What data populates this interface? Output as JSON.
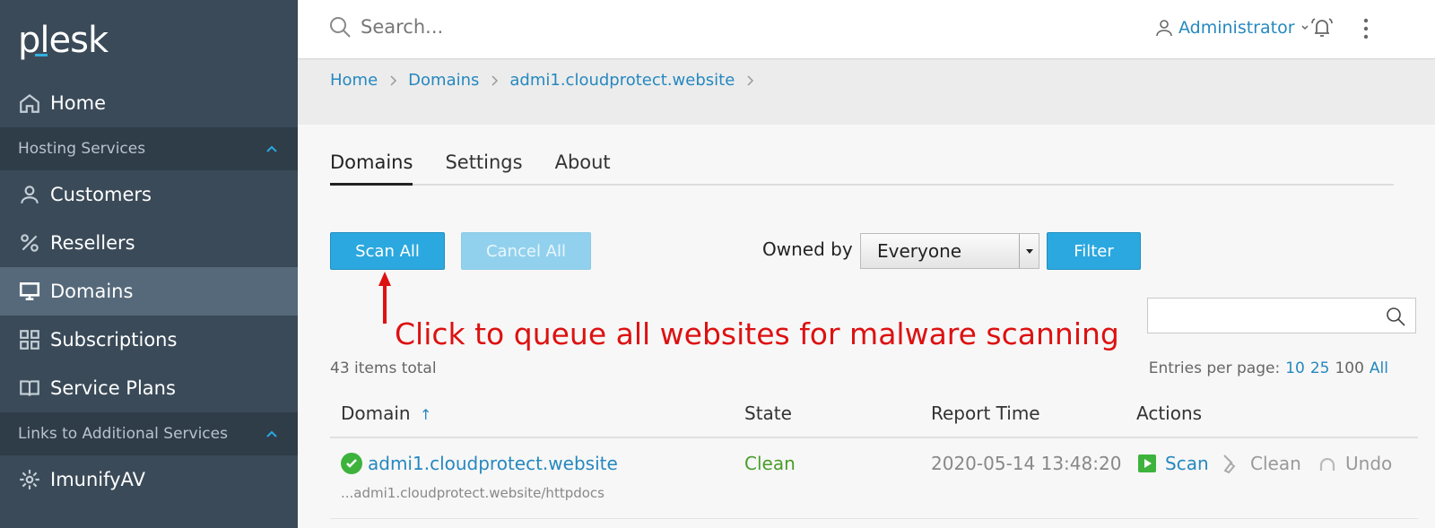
{
  "app": {
    "logo_text": "plesk"
  },
  "sidebar": {
    "items": [
      {
        "label": "Home"
      },
      {
        "group": "Hosting Services"
      },
      {
        "label": "Customers"
      },
      {
        "label": "Resellers"
      },
      {
        "label": "Domains",
        "active": true
      },
      {
        "label": "Subscriptions"
      },
      {
        "label": "Service Plans"
      },
      {
        "group": "Links to Additional Services"
      },
      {
        "label": "ImunifyAV"
      }
    ]
  },
  "topbar": {
    "search_placeholder": "Search...",
    "user": "Administrator"
  },
  "breadcrumb": [
    "Home",
    "Domains",
    "admi1.cloudprotect.website"
  ],
  "tabs": [
    "Domains",
    "Settings",
    "About"
  ],
  "toolbar": {
    "scan_all": "Scan All",
    "cancel_all": "Cancel All",
    "owned_by_label": "Owned by",
    "owned_by_value": "Everyone",
    "filter": "Filter"
  },
  "annotation": "Click to queue all websites for malware scanning",
  "list": {
    "items_total": "43 items total",
    "entries_label": "Entries per page:",
    "entries_options": [
      "10",
      "25",
      "100",
      "All"
    ],
    "columns": [
      "Domain",
      "State",
      "Report Time",
      "Actions"
    ],
    "rows": [
      {
        "domain": "admi1.cloudprotect.website",
        "path": "...admi1.cloudprotect.website/httpdocs",
        "state": "Clean",
        "report_time": "2020-05-14 13:48:20",
        "actions": [
          "Scan",
          "Clean",
          "Undo"
        ]
      }
    ]
  },
  "colors": {
    "accent": "#2ba8df",
    "link": "#2588bf",
    "clean": "#4a9d2a",
    "annotation": "#dd1111"
  }
}
